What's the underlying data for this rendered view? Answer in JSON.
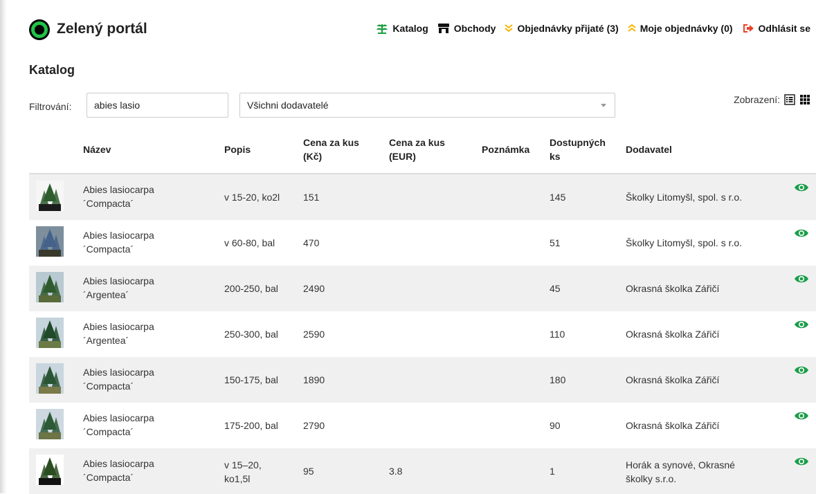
{
  "app": {
    "brand": "Zelený portál"
  },
  "nav": [
    {
      "label": "Katalog",
      "icon": "leaf-icon"
    },
    {
      "label": "Obchody",
      "icon": "store-icon"
    },
    {
      "label": "Objednávky přijaté (3)",
      "icon": "chevrons-down-icon"
    },
    {
      "label": "Moje objednávky (0)",
      "icon": "chevrons-up-icon"
    },
    {
      "label": "Odhlásit se",
      "icon": "sign-out-icon"
    }
  ],
  "page": {
    "title": "Katalog"
  },
  "filter": {
    "label": "Filtrování:",
    "value": "abies lasio",
    "supplier_selected": "Všichni dodavatelé"
  },
  "view": {
    "label": "Zobrazení:"
  },
  "table": {
    "headers": {
      "name": "Název",
      "desc": "Popis",
      "price_czk": [
        "Cena za kus",
        "(Kč)"
      ],
      "price_eur": [
        "Cena za kus",
        "(EUR)"
      ],
      "note": "Poznámka",
      "available": [
        "Dostupných",
        "ks"
      ],
      "supplier": "Dodavatel"
    },
    "rows": [
      {
        "name": [
          "Abies lasiocarpa",
          "´Compacta´"
        ],
        "desc": [
          "v 15-20, ko2l"
        ],
        "price_czk": "151",
        "price_eur": "",
        "note": "",
        "available": "145",
        "supplier": [
          "Školky Litomyšl, spol. s r.o."
        ]
      },
      {
        "name": [
          "Abies lasiocarpa",
          "´Compacta´"
        ],
        "desc": [
          "v 60-80, bal"
        ],
        "price_czk": "470",
        "price_eur": "",
        "note": "",
        "available": "51",
        "supplier": [
          "Školky Litomyšl, spol. s r.o."
        ]
      },
      {
        "name": [
          "Abies lasiocarpa",
          "´Argentea´"
        ],
        "desc": [
          "200-250, bal"
        ],
        "price_czk": "2490",
        "price_eur": "",
        "note": "",
        "available": "45",
        "supplier": [
          "Okrasná školka Zářičí"
        ]
      },
      {
        "name": [
          "Abies lasiocarpa",
          "´Argentea´"
        ],
        "desc": [
          "250-300, bal"
        ],
        "price_czk": "2590",
        "price_eur": "",
        "note": "",
        "available": "110",
        "supplier": [
          "Okrasná školka Zářičí"
        ]
      },
      {
        "name": [
          "Abies lasiocarpa",
          "´Compacta´"
        ],
        "desc": [
          "150-175, bal"
        ],
        "price_czk": "1890",
        "price_eur": "",
        "note": "",
        "available": "180",
        "supplier": [
          "Okrasná školka Zářičí"
        ]
      },
      {
        "name": [
          "Abies lasiocarpa",
          "´Compacta´"
        ],
        "desc": [
          "175-200, bal"
        ],
        "price_czk": "2790",
        "price_eur": "",
        "note": "",
        "available": "90",
        "supplier": [
          "Okrasná školka Zářičí"
        ]
      },
      {
        "name": [
          "Abies lasiocarpa",
          "´Compacta´"
        ],
        "desc": [
          "v 15–20,",
          "ko1,5l"
        ],
        "price_czk": "95",
        "price_eur": "3.8",
        "note": "",
        "available": "1",
        "supplier": [
          "Horák a synové, Okrasné",
          "školky s.r.o."
        ]
      }
    ]
  },
  "colors": {
    "accent_green": "#1a9e3f",
    "nav_orange": "#f5b400",
    "logout_red": "#e8442a",
    "eye_green": "#1b9e4a",
    "row_stripe": "#f0f0f0"
  }
}
